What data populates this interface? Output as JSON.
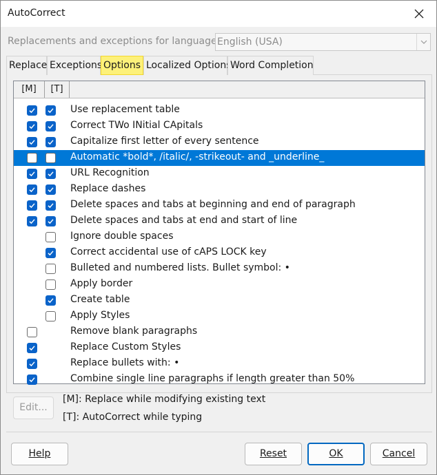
{
  "window": {
    "title": "AutoCorrect"
  },
  "language": {
    "label": "Replacements and exceptions for language:",
    "value": "English (USA)"
  },
  "tabs": [
    {
      "label": "Replace"
    },
    {
      "label": "Exceptions"
    },
    {
      "label": "Options",
      "active": true
    },
    {
      "label": "Localized Options"
    },
    {
      "label": "Word Completion"
    }
  ],
  "list": {
    "col_m": "[M]",
    "col_t": "[T]",
    "rows": [
      {
        "label": "Use replacement table",
        "m": true,
        "t": true
      },
      {
        "label": "Correct TWo INitial CApitals",
        "m": true,
        "t": true
      },
      {
        "label": "Capitalize first letter of every sentence",
        "m": true,
        "t": true
      },
      {
        "label": "Automatic *bold*, /italic/, -strikeout- and _underline_",
        "m": false,
        "t": false,
        "selected": true
      },
      {
        "label": "URL Recognition",
        "m": true,
        "t": true
      },
      {
        "label": "Replace dashes",
        "m": true,
        "t": true
      },
      {
        "label": "Delete spaces and tabs at beginning and end of paragraph",
        "m": true,
        "t": true
      },
      {
        "label": "Delete spaces and tabs at end and start of line",
        "m": true,
        "t": true
      },
      {
        "label": "Ignore double spaces",
        "m": null,
        "t": false
      },
      {
        "label": "Correct accidental use of cAPS LOCK key",
        "m": null,
        "t": true
      },
      {
        "label": "Bulleted and numbered lists. Bullet symbol: •",
        "m": null,
        "t": false
      },
      {
        "label": "Apply border",
        "m": null,
        "t": false
      },
      {
        "label": "Create table",
        "m": null,
        "t": true
      },
      {
        "label": "Apply Styles",
        "m": null,
        "t": false
      },
      {
        "label": "Remove blank paragraphs",
        "m": false,
        "t": null
      },
      {
        "label": "Replace Custom Styles",
        "m": true,
        "t": null
      },
      {
        "label": "Replace bullets with: •",
        "m": true,
        "t": null
      },
      {
        "label": "Combine single line paragraphs if length greater than 50%",
        "m": true,
        "t": null
      }
    ]
  },
  "edit_button": "Edit...",
  "legend": {
    "m": "[M]: Replace while modifying existing text",
    "t": "[T]: AutoCorrect while typing"
  },
  "buttons": {
    "help": "Help",
    "reset": "Reset",
    "ok": "OK",
    "cancel": "Cancel"
  },
  "colors": {
    "selection": "#0078d7",
    "checkbox": "#0a63c9",
    "active_tab": "#fdf17a"
  },
  "icons": {
    "close": "close-icon",
    "dropdown": "chevron-down-icon",
    "check": "check-icon"
  }
}
